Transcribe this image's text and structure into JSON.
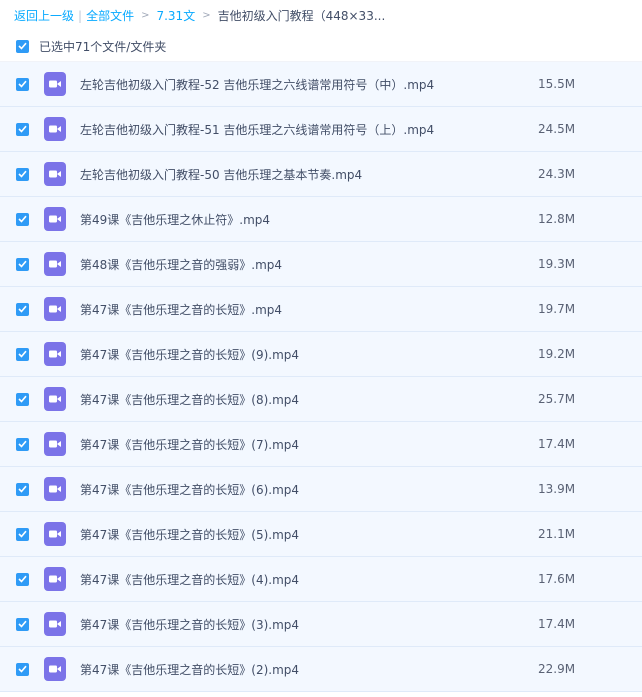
{
  "breadcrumb": {
    "back": "返回上一级",
    "separator": "|",
    "all_files": "全部文件",
    "arrow": ">",
    "folder": "7.31文",
    "current": "吉他初级入门教程（448×33..."
  },
  "selection": {
    "label": "已选中71个文件/文件夹"
  },
  "files": [
    {
      "name": "左轮吉他初级入门教程-52 吉他乐理之六线谱常用符号（中）.mp4",
      "size": "15.5M"
    },
    {
      "name": "左轮吉他初级入门教程-51 吉他乐理之六线谱常用符号（上）.mp4",
      "size": "24.5M"
    },
    {
      "name": "左轮吉他初级入门教程-50 吉他乐理之基本节奏.mp4",
      "size": "24.3M"
    },
    {
      "name": "第49课《吉他乐理之休止符》.mp4",
      "size": "12.8M"
    },
    {
      "name": "第48课《吉他乐理之音的强弱》.mp4",
      "size": "19.3M"
    },
    {
      "name": "第47课《吉他乐理之音的长短》.mp4",
      "size": "19.7M"
    },
    {
      "name": "第47课《吉他乐理之音的长短》(9).mp4",
      "size": "19.2M"
    },
    {
      "name": "第47课《吉他乐理之音的长短》(8).mp4",
      "size": "25.7M"
    },
    {
      "name": "第47课《吉他乐理之音的长短》(7).mp4",
      "size": "17.4M"
    },
    {
      "name": "第47课《吉他乐理之音的长短》(6).mp4",
      "size": "13.9M"
    },
    {
      "name": "第47课《吉他乐理之音的长短》(5).mp4",
      "size": "21.1M"
    },
    {
      "name": "第47课《吉他乐理之音的长短》(4).mp4",
      "size": "17.6M"
    },
    {
      "name": "第47课《吉他乐理之音的长短》(3).mp4",
      "size": "17.4M"
    },
    {
      "name": "第47课《吉他乐理之音的长短》(2).mp4",
      "size": "22.9M"
    }
  ],
  "colors": {
    "accent": "#09aaff",
    "checkbox": "#2f9bf6",
    "video_icon": "#7b73e8",
    "row_selected": "#f3f8ff"
  }
}
